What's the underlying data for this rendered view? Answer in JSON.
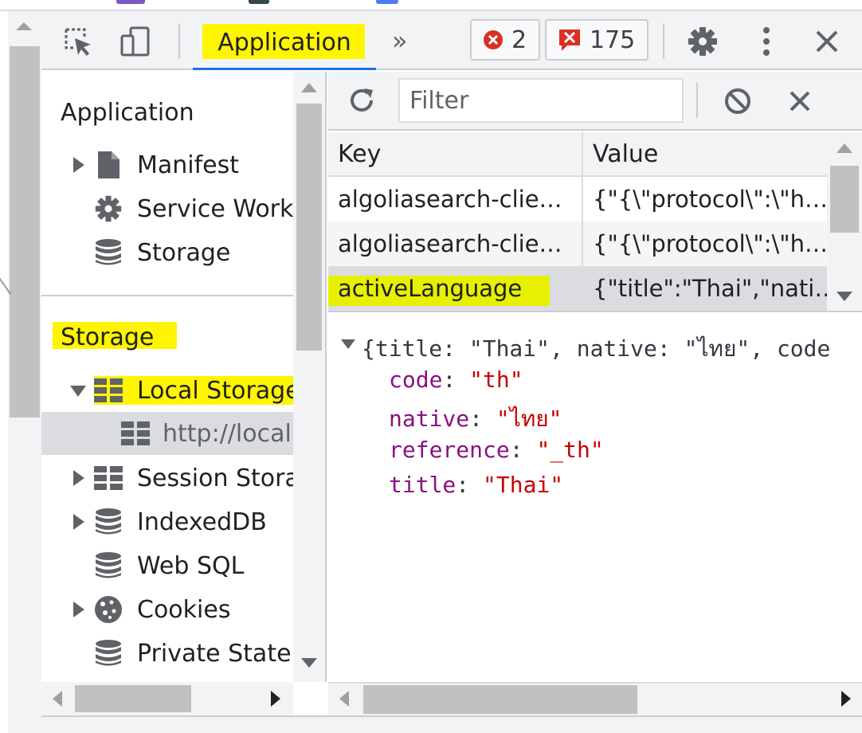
{
  "toolbar": {
    "active_tab": "Application",
    "more_tabs": "»",
    "error_count": "2",
    "issue_count": "175"
  },
  "sidebar": {
    "application_header": "Application",
    "application_items": [
      {
        "label": "Manifest",
        "icon": "file-icon"
      },
      {
        "label": "Service Workers",
        "icon": "gear-icon"
      },
      {
        "label": "Storage",
        "icon": "database-icon"
      }
    ],
    "storage_header": "Storage",
    "storage_items": [
      {
        "label": "Local Storage",
        "icon": "grid-icon"
      },
      {
        "label": "http://localhost",
        "icon": "grid-icon"
      },
      {
        "label": "Session Storage",
        "icon": "grid-icon"
      },
      {
        "label": "IndexedDB",
        "icon": "database-icon"
      },
      {
        "label": "Web SQL",
        "icon": "database-icon"
      },
      {
        "label": "Cookies",
        "icon": "cookie-icon"
      },
      {
        "label": "Private State Tokens",
        "icon": "database-icon"
      }
    ]
  },
  "storage_view": {
    "filter_placeholder": "Filter",
    "columns": [
      "Key",
      "Value"
    ],
    "rows": [
      {
        "key": "algoliasearch-clie…",
        "value": "{\"{\\\"protocol\\\":\\\"h…"
      },
      {
        "key": "algoliasearch-clie…",
        "value": "{\"{\\\"protocol\\\":\\\"h…"
      },
      {
        "key": "activeLanguage",
        "value": "{\"title\":\"Thai\",\"nati…"
      }
    ]
  },
  "detail": {
    "summary": "{title: \"Thai\", native: \"ไทย\", code",
    "props": [
      {
        "key": "code",
        "value": "\"th\""
      },
      {
        "key": "native",
        "value": "\"ไทย\""
      },
      {
        "key": "reference",
        "value": "\"_th\""
      },
      {
        "key": "title",
        "value": "\"Thai\""
      }
    ]
  },
  "colors": {
    "highlight": "#fff500",
    "accent_blue": "#1a73e8",
    "error_red": "#d93025",
    "key_purple": "#881280",
    "string_red": "#c80000"
  }
}
